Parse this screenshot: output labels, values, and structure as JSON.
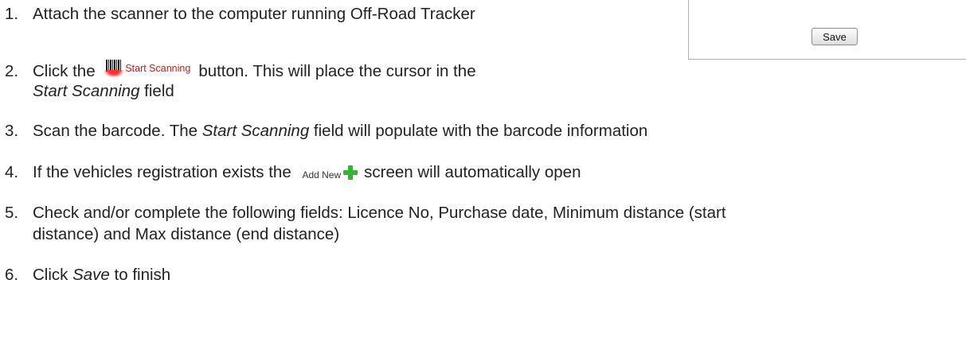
{
  "panel": {
    "save_label": "Save"
  },
  "steps": [
    {
      "num": "1.",
      "text": "Attach the scanner to the computer running Off-Road Tracker"
    },
    {
      "num": "2.",
      "before": "Click the",
      "button_label": "Start Scanning",
      "after": "button.  This will place the cursor in the",
      "line2_em": "Start Scanning",
      "line2_rest": " field"
    },
    {
      "num": "3.",
      "before": "Scan the barcode.  The ",
      "em": "Start Scanning",
      "after": " field will populate with the barcode information"
    },
    {
      "num": "4.",
      "before": "If the vehicles registration exists the",
      "button_label": "Add New",
      "after": "screen will automatically open"
    },
    {
      "num": "5.",
      "text": "Check and/or complete the following fields: Licence No, Purchase date, Minimum distance (start",
      "text2": "distance) and Max distance (end distance)"
    },
    {
      "num": "6.",
      "before": "Click ",
      "em": "Save",
      "after": " to finish"
    }
  ],
  "icons": {
    "barcode": "barcode-scanner-icon",
    "add": "green-plus-icon"
  },
  "colors": {
    "start_scanning_text": "#d01818",
    "plus": "#36b336"
  }
}
